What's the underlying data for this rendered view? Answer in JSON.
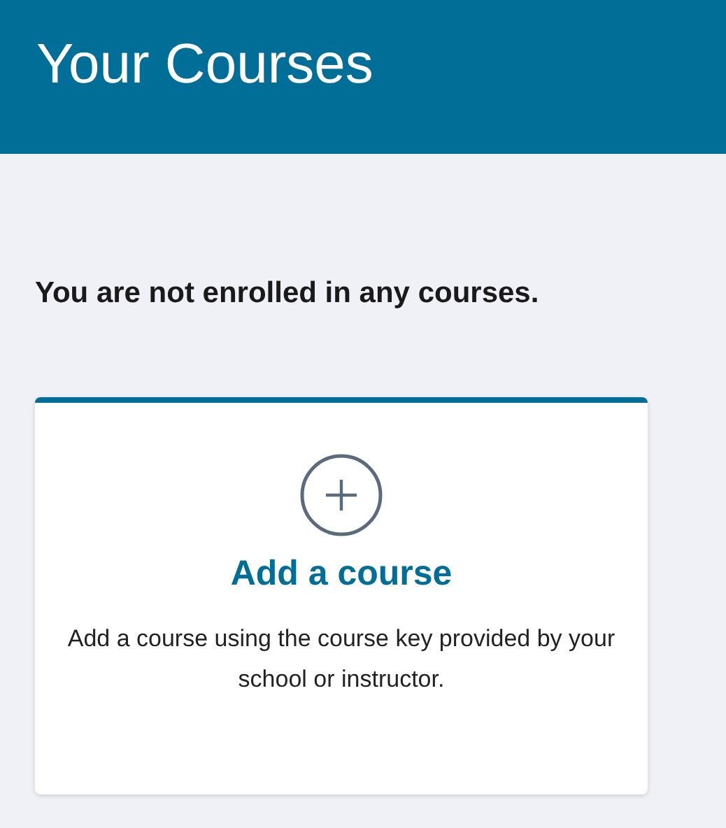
{
  "header": {
    "title": "Your Courses"
  },
  "message": "You are not enrolled in any courses.",
  "add_card": {
    "title": "Add a course",
    "description": "Add a course using the course key provided by your school or instructor."
  }
}
